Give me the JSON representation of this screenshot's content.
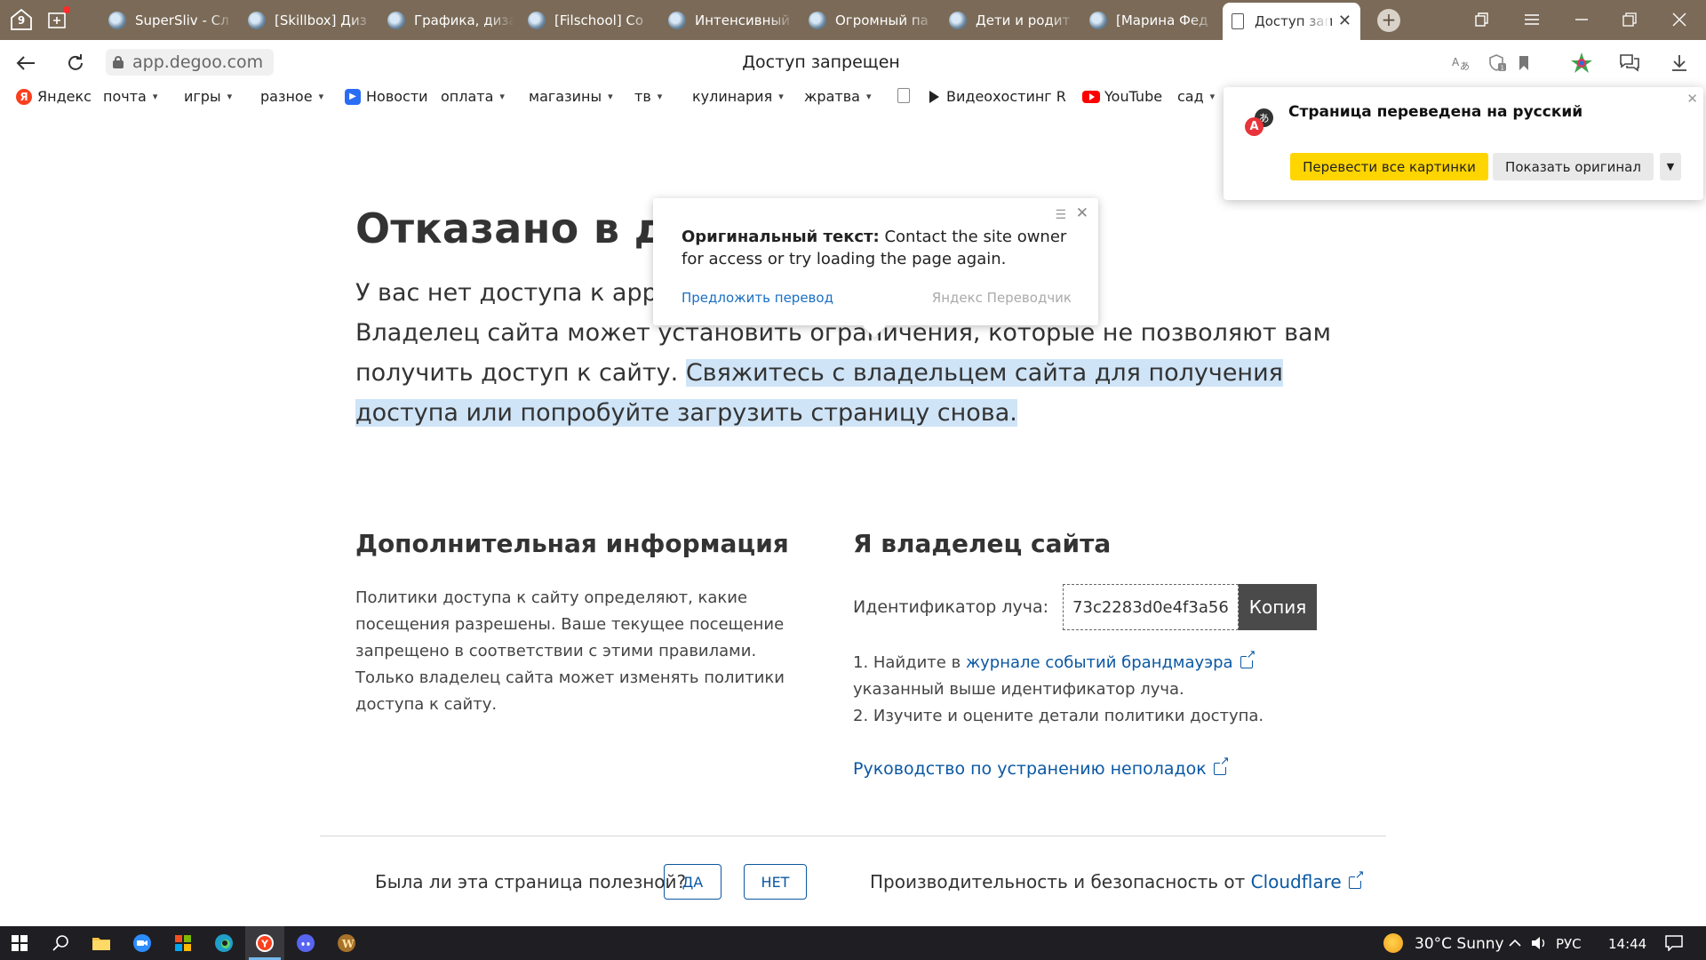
{
  "browser": {
    "home_count": "9",
    "tabs": [
      {
        "label": "SuperSliv - Сл"
      },
      {
        "label": "[Skillbox] Диз"
      },
      {
        "label": "Графика, диза"
      },
      {
        "label": "[Filschool] Со"
      },
      {
        "label": "Интенсивный"
      },
      {
        "label": "Огромный па"
      },
      {
        "label": "Дети и родит"
      },
      {
        "label": "[Марина Фед"
      },
      {
        "label": "Доступ зап"
      }
    ],
    "url": "app.degoo.com",
    "page_title": "Доступ запрещен"
  },
  "bookmarks": [
    {
      "label": "Яндекс",
      "menu": false
    },
    {
      "label": "почта",
      "menu": true
    },
    {
      "label": "игры",
      "menu": true
    },
    {
      "label": "разное",
      "menu": true
    },
    {
      "label": "Новости",
      "menu": false
    },
    {
      "label": "оплата",
      "menu": true
    },
    {
      "label": "магазины",
      "menu": true
    },
    {
      "label": "тв",
      "menu": true
    },
    {
      "label": "кулинария",
      "menu": true
    },
    {
      "label": "жратва",
      "menu": true
    },
    {
      "label": "Видеохостинг Rut",
      "menu": false
    },
    {
      "label": "YouTube",
      "menu": false
    },
    {
      "label": "сад",
      "menu": true
    }
  ],
  "page": {
    "heading": "Отказано в до",
    "lead_1": "У вас нет доступа к app.c",
    "lead_2": "Владелец сайта может установить ограничения, которые не позволяют вам получить доступ к сайту.",
    "lead_highlight": "Свяжитесь с владельцем сайта для получения доступа или попробуйте загрузить страницу снова.",
    "info_heading": "Дополнительная информация",
    "info_p1": "Политики доступа к сайту определяют, какие посещения разрешены. Ваше текущее посещение запрещено в соответствии с этими правилами.",
    "info_p2": "Только владелец сайта может изменять политики доступа к сайту.",
    "owner_heading": "Я владелец сайта",
    "ray_label": "Идентификатор луча:",
    "ray_id": "73c2283d0e4f3a56",
    "copy_label": "Копия",
    "step1_prefix": "1. Найдите в",
    "step1_link": "журнале событий брандмауэра",
    "step1_suffix": "указанный выше идентификатор луча.",
    "step2": "2. Изучите и оцените детали политики доступа.",
    "troubleshoot_link": "Руководство по устранению неполадок",
    "footer_question": "Была ли эта страница полезной?",
    "yes_label": "ДА",
    "no_label": "НЕТ",
    "footer_cf_prefix": "Производительность и безопасность от",
    "footer_cf_link": "Cloudflare"
  },
  "bubble": {
    "label": "Оригинальный текст:",
    "original": "Contact the site owner for access or try loading the page again.",
    "suggest": "Предложить перевод",
    "brand": "Яндекс Переводчик"
  },
  "translate_panel": {
    "title": "Страница переведена на русский",
    "translate_images": "Перевести все картинки",
    "show_original": "Показать оригинал"
  },
  "taskbar": {
    "weather": "30°C  Sunny",
    "lang": "РУС",
    "time": "14:44"
  }
}
